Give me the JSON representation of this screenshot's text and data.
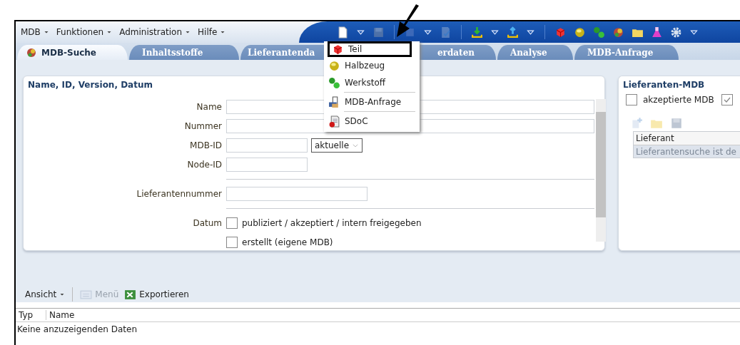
{
  "annotations": [
    {
      "kind": "arrow"
    }
  ],
  "menubar": [
    {
      "label": "MDB"
    },
    {
      "label": "Funktionen"
    },
    {
      "label": "Administration"
    },
    {
      "label": "Hilfe"
    }
  ],
  "toolbar": [
    {
      "kind": "document",
      "disabled": false
    },
    {
      "kind": "caret",
      "disabled": false
    },
    {
      "kind": "save",
      "disabled": true
    },
    {
      "kind": "sep"
    },
    {
      "kind": "blank",
      "disabled": false
    },
    {
      "kind": "caret",
      "disabled": false
    },
    {
      "kind": "check-doc",
      "disabled": true
    },
    {
      "kind": "sep"
    },
    {
      "kind": "download",
      "disabled": false
    },
    {
      "kind": "caret",
      "disabled": false
    },
    {
      "kind": "upload",
      "disabled": false
    },
    {
      "kind": "caret",
      "disabled": false
    },
    {
      "kind": "sep"
    },
    {
      "kind": "cube",
      "disabled": false
    },
    {
      "kind": "sphere",
      "disabled": false
    },
    {
      "kind": "spheres",
      "disabled": false
    },
    {
      "kind": "mix",
      "disabled": false
    },
    {
      "kind": "folder",
      "disabled": false
    },
    {
      "kind": "flask",
      "disabled": false
    },
    {
      "kind": "gear",
      "disabled": false
    },
    {
      "kind": "caret",
      "disabled": false
    }
  ],
  "tabs": [
    {
      "label": "MDB-Suche",
      "selected": true
    },
    {
      "label": "Inhaltsstoffe",
      "selected": false
    },
    {
      "label": "Lieferantenda",
      "selected": false
    },
    {
      "label": "erdaten",
      "selected": false
    },
    {
      "label": "Analyse",
      "selected": false
    },
    {
      "label": "MDB-Anfrage",
      "selected": false
    }
  ],
  "new_menu": {
    "items": [
      {
        "kind": "cube",
        "label": "Teil",
        "selected": true
      },
      {
        "kind": "sphere",
        "label": "Halbzeug",
        "selected": false
      },
      {
        "kind": "spheres",
        "label": "Werkstoff",
        "selected": false
      },
      {
        "kind": "separator"
      },
      {
        "kind": "request",
        "label": "MDB-Anfrage",
        "selected": false
      },
      {
        "kind": "separator"
      },
      {
        "kind": "sdoc",
        "label": "SDoC",
        "selected": false
      }
    ]
  },
  "search_panel": {
    "title": "Name, ID, Version, Datum",
    "fields": [
      {
        "kind": "long",
        "label": "Name"
      },
      {
        "kind": "long",
        "label": "Nummer"
      },
      {
        "kind": "short-select",
        "label": "MDB-ID",
        "select": "aktuelle"
      },
      {
        "kind": "short",
        "label": "Node-ID"
      },
      {
        "kind": "rule"
      },
      {
        "kind": "medium",
        "label": "Lieferantennummer"
      },
      {
        "kind": "rule"
      },
      {
        "kind": "checkbox",
        "label": "Datum",
        "text": "publiziert / akzeptiert / intern freigegeben",
        "checked": false
      },
      {
        "kind": "checkbox",
        "text": "erstellt (eigene MDB)",
        "checked": false
      }
    ]
  },
  "supplier_panel": {
    "title": "Lieferanten-MDB",
    "checks": [
      {
        "label": "akzeptierte MDB",
        "checked": false
      },
      {
        "checked": true
      }
    ],
    "tools": [
      {
        "kind": "add"
      },
      {
        "kind": "folder"
      },
      {
        "kind": "save"
      }
    ],
    "columns": [
      "Lieferant"
    ],
    "rows": [
      [
        "Lieferantensuche ist de"
      ]
    ]
  },
  "results": {
    "toolbar": [
      {
        "kind": "menu",
        "label": "Ansicht",
        "disabled": false
      },
      {
        "kind": "sep"
      },
      {
        "kind": "menu-icon",
        "label": "Menü",
        "disabled": true
      },
      {
        "kind": "excel",
        "label": "Exportieren",
        "disabled": false
      }
    ],
    "columns": [
      "Typ",
      "Name"
    ],
    "empty_text": "Keine anzuzeigenden Daten"
  }
}
